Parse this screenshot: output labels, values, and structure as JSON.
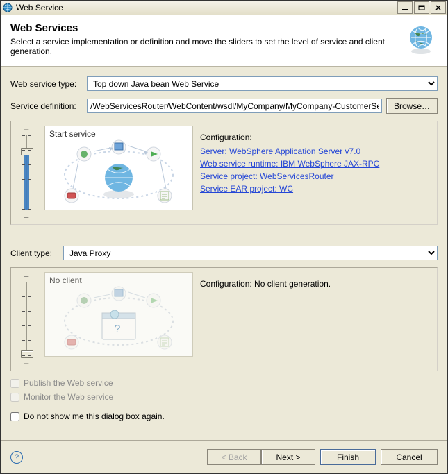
{
  "window": {
    "title": "Web Service"
  },
  "header": {
    "title": "Web Services",
    "subtitle": "Select a service implementation or definition and move the sliders to set the level of service and client generation."
  },
  "fields": {
    "web_service_type_label": "Web service type:",
    "web_service_type_value": "Top down Java bean Web Service",
    "service_definition_label": "Service definition:",
    "service_definition_value": "/WebServicesRouter/WebContent/wsdl/MyCompany/MyCompany-CustomerServices.wsdl",
    "browse": "Browse…",
    "client_type_label": "Client type:",
    "client_type_value": "Java Proxy"
  },
  "service_section": {
    "illus_label": "Start service",
    "config_label": "Configuration:",
    "server": "Server: WebSphere Application Server v7.0",
    "runtime": "Web service runtime: IBM WebSphere JAX-RPC",
    "project": "Service project: WebServicesRouter",
    "ear": "Service EAR project: WC"
  },
  "client_section": {
    "illus_label": "No client",
    "config_text": "Configuration: No client generation."
  },
  "checks": {
    "publish": "Publish the Web service",
    "monitor": "Monitor the Web service",
    "dont_show": "Do not show me this dialog box again."
  },
  "buttons": {
    "back": "< Back",
    "next": "Next >",
    "finish": "Finish",
    "cancel": "Cancel"
  }
}
